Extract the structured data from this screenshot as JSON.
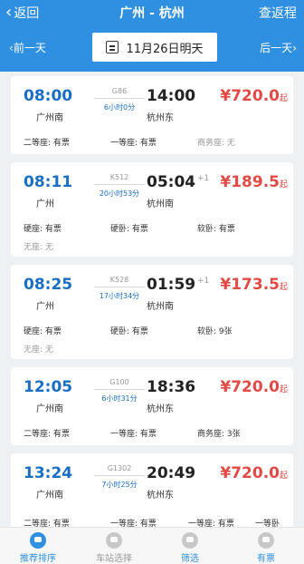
{
  "header": {
    "back_label": "返回",
    "title": "广州 - 杭州",
    "return_label": "查返程",
    "prev_day": "前一天",
    "date": "11月26日明天",
    "next_day": "后一天"
  },
  "trains": [
    {
      "dep_time": "08:00",
      "dep_station": "广州南",
      "train_no": "G86",
      "duration": "6小时0分",
      "arr_time": "14:00",
      "arr_day": "",
      "arr_station": "杭州东",
      "price": "¥720.0",
      "price_suffix": "起",
      "seats": [
        {
          "text": "二等座: 有票",
          "muted": false
        },
        {
          "text": "一等座: 有票",
          "muted": false
        },
        {
          "text": "商务座: 无",
          "muted": true
        }
      ]
    },
    {
      "dep_time": "08:11",
      "dep_station": "广州",
      "train_no": "K512",
      "duration": "20小时53分",
      "arr_time": "05:04",
      "arr_day": "+1",
      "arr_station": "杭州南",
      "price": "¥189.5",
      "price_suffix": "起",
      "seats": [
        {
          "text": "硬座: 有票",
          "muted": false
        },
        {
          "text": "硬卧: 有票",
          "muted": false
        },
        {
          "text": "软卧: 有票",
          "muted": false
        },
        {
          "text": "无座: 无",
          "muted": true
        }
      ]
    },
    {
      "dep_time": "08:25",
      "dep_station": "广州",
      "train_no": "K528",
      "duration": "17小时34分",
      "arr_time": "01:59",
      "arr_day": "+1",
      "arr_station": "杭州南",
      "price": "¥173.5",
      "price_suffix": "起",
      "seats": [
        {
          "text": "硬座: 有票",
          "muted": false
        },
        {
          "text": "硬卧: 有票",
          "muted": false
        },
        {
          "text": "软卧: 9张",
          "muted": false
        },
        {
          "text": "无座: 无",
          "muted": true
        }
      ]
    },
    {
      "dep_time": "12:05",
      "dep_station": "广州南",
      "train_no": "G100",
      "duration": "6小时31分",
      "arr_time": "18:36",
      "arr_day": "",
      "arr_station": "杭州东",
      "price": "¥720.0",
      "price_suffix": "起",
      "seats": [
        {
          "text": "二等座: 有票",
          "muted": false
        },
        {
          "text": "一等座: 有票",
          "muted": false
        },
        {
          "text": "商务座: 3张",
          "muted": false
        }
      ]
    },
    {
      "dep_time": "13:24",
      "dep_station": "广州南",
      "train_no": "G1302",
      "duration": "7小时25分",
      "arr_time": "20:49",
      "arr_day": "",
      "arr_station": "杭州东",
      "price": "¥720.0",
      "price_suffix": "起",
      "seats": [
        {
          "text": "二等座: 有票",
          "muted": false
        },
        {
          "text": "一等座: 有票",
          "muted": false
        },
        {
          "text": "一等座: 有票",
          "muted": false
        },
        {
          "text": "一等卧",
          "muted": false
        }
      ]
    }
  ],
  "tabs": [
    {
      "label": "推荐排序",
      "icon": "sort-icon"
    },
    {
      "label": "车站选择",
      "icon": "station-icon"
    },
    {
      "label": "筛选",
      "icon": "filter-icon"
    },
    {
      "label": "有票",
      "icon": "ticket-icon"
    }
  ],
  "colors": {
    "accent": "#2f8fe0",
    "price": "#e24a45",
    "time": "#1a6fc4"
  }
}
